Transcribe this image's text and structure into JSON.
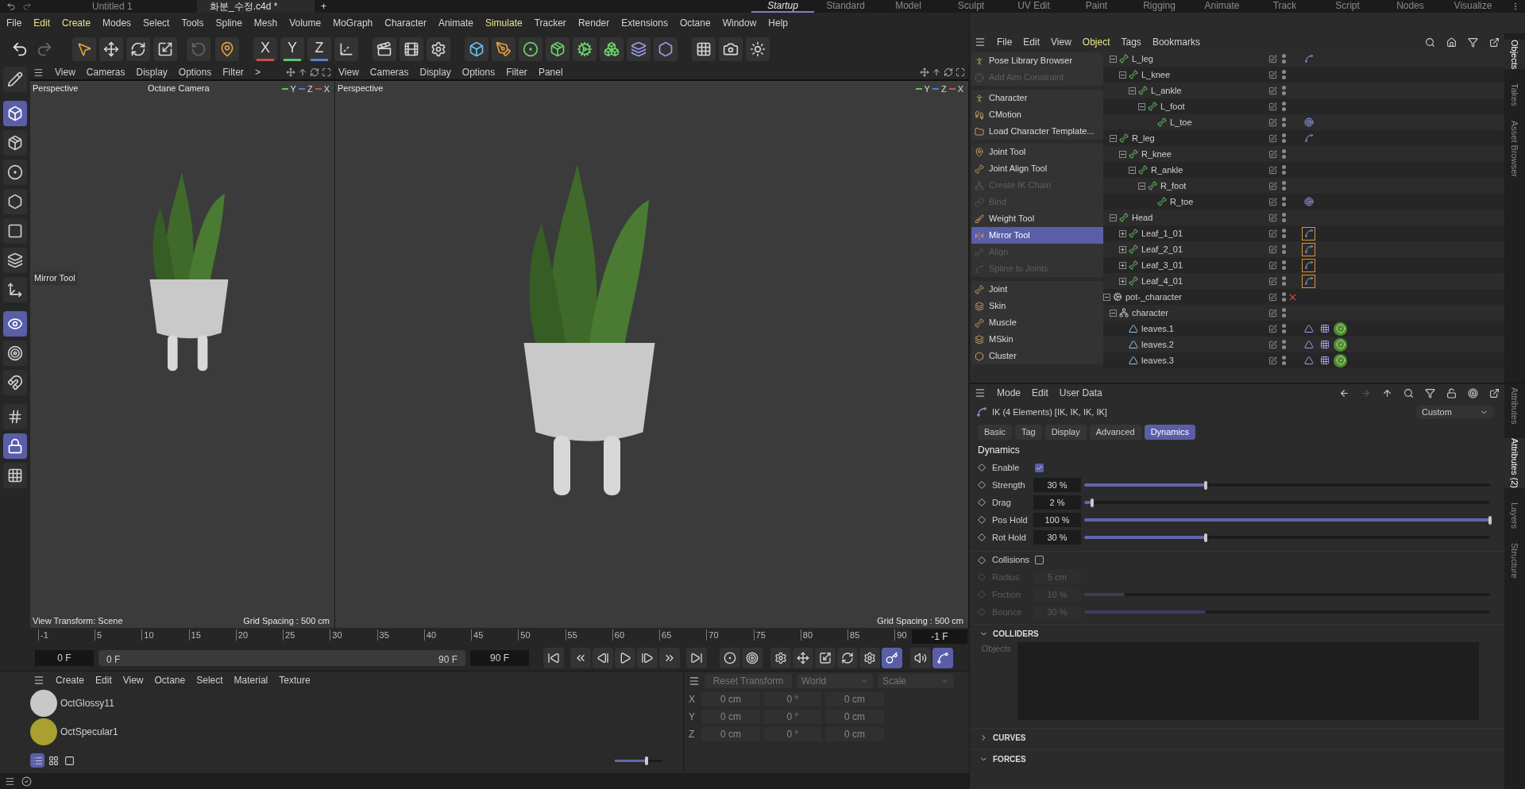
{
  "top_bar": {
    "tabs": [
      {
        "label": "Untitled 1",
        "selected": false
      },
      {
        "label": "화분_수정.c4d *",
        "selected": true
      }
    ],
    "new_tab": "+",
    "layouts": [
      {
        "label": "Startup",
        "selected": true
      },
      {
        "label": "Standard",
        "selected": false
      },
      {
        "label": "Model",
        "selected": false
      },
      {
        "label": "Sculpt",
        "selected": false
      },
      {
        "label": "UV Edit",
        "selected": false
      },
      {
        "label": "Paint",
        "selected": false
      },
      {
        "label": "Rigging",
        "selected": false
      },
      {
        "label": "Animate",
        "selected": false
      },
      {
        "label": "Track",
        "selected": false
      },
      {
        "label": "Script",
        "selected": false
      },
      {
        "label": "Nodes",
        "selected": false
      },
      {
        "label": "Visualize",
        "selected": false
      }
    ]
  },
  "menu": [
    {
      "label": "File",
      "highlighted": false
    },
    {
      "label": "Edit",
      "highlighted": true
    },
    {
      "label": "Create",
      "highlighted": true
    },
    {
      "label": "Modes",
      "highlighted": false
    },
    {
      "label": "Select",
      "highlighted": false
    },
    {
      "label": "Tools",
      "highlighted": false
    },
    {
      "label": "Spline",
      "highlighted": false
    },
    {
      "label": "Mesh",
      "highlighted": false
    },
    {
      "label": "Volume",
      "highlighted": false
    },
    {
      "label": "MoGraph",
      "highlighted": false
    },
    {
      "label": "Character",
      "highlighted": false
    },
    {
      "label": "Animate",
      "highlighted": false
    },
    {
      "label": "Simulate",
      "highlighted": true
    },
    {
      "label": "Tracker",
      "highlighted": false
    },
    {
      "label": "Render",
      "highlighted": false
    },
    {
      "label": "Extensions",
      "highlighted": false
    },
    {
      "label": "Octane",
      "highlighted": false
    },
    {
      "label": "Window",
      "highlighted": false
    },
    {
      "label": "Help",
      "highlighted": false
    }
  ],
  "axis_lock": [
    {
      "label": "X",
      "color": "#d24a4a"
    },
    {
      "label": "Y",
      "color": "#62c462"
    },
    {
      "label": "Z",
      "color": "#4f7fd8"
    }
  ],
  "left_tools": [
    {
      "kind": "edit",
      "selected": false
    },
    {
      "kind": "model",
      "selected": true
    },
    {
      "kind": "texture",
      "selected": false
    },
    {
      "kind": "point",
      "selected": false
    },
    {
      "kind": "edge",
      "selected": false
    },
    {
      "kind": "polygon",
      "selected": false
    },
    {
      "kind": "uv",
      "selected": false
    },
    {
      "kind": "axis",
      "selected": false
    },
    {
      "kind": "solo",
      "selected": true
    },
    {
      "kind": "auto",
      "selected": false
    },
    {
      "kind": "snap",
      "selected": false
    },
    {
      "kind": "grid",
      "selected": false
    },
    {
      "kind": "grid-lock",
      "selected": true
    },
    {
      "kind": "grid-auto",
      "selected": false
    }
  ],
  "viewports": [
    {
      "menu": [
        "View",
        "Cameras",
        "Display",
        "Options",
        "Filter",
        ">"
      ],
      "camera": "Perspective",
      "renderer": "Octane Camera",
      "tool": "Mirror Tool",
      "transform": "View Transform: Scene",
      "grid": "Grid Spacing : 500 cm",
      "gizmo": [
        {
          "label": "Y",
          "color": "#62c462"
        },
        {
          "label": "Z",
          "color": "#4f7fd8"
        },
        {
          "label": "X",
          "color": "#d24a4a"
        }
      ]
    },
    {
      "menu": [
        "View",
        "Cameras",
        "Display",
        "Options",
        "Filter",
        "Panel"
      ],
      "camera": "Perspective",
      "grid": "Grid Spacing : 500 cm",
      "gizmo": [
        {
          "label": "Y",
          "color": "#62c462"
        },
        {
          "label": "Z",
          "color": "#4f7fd8"
        },
        {
          "label": "X",
          "color": "#d24a4a"
        }
      ]
    }
  ],
  "timeline": {
    "ticks": [
      "-1",
      "5",
      "10",
      "15",
      "20",
      "25",
      "30",
      "35",
      "40",
      "45",
      "50",
      "55",
      "60",
      "65",
      "70",
      "75",
      "80",
      "85",
      "90"
    ],
    "current_frame": "-1 F",
    "start": "0 F",
    "range_start": "0 F",
    "range_end": "90 F",
    "range_bar": {
      "level": 1.0
    },
    "end": "90 F"
  },
  "key_tools": [
    {
      "kind": "record",
      "on": false
    },
    {
      "kind": "autokey",
      "on": false
    },
    {
      "kind": "keys",
      "on": false
    },
    {
      "kind": "position",
      "on": false
    },
    {
      "kind": "scale",
      "on": false
    },
    {
      "kind": "rotation",
      "on": false
    },
    {
      "kind": "parameter",
      "on": false
    },
    {
      "kind": "pla",
      "on": true
    },
    {
      "kind": "sound",
      "on": false
    },
    {
      "kind": "interpolation",
      "on": true
    }
  ],
  "materials": {
    "menu": [
      "Create",
      "Edit",
      "View",
      "Octane",
      "Select",
      "Material",
      "Texture"
    ],
    "items": [
      {
        "name": "OctGlossy11",
        "kind": "glossy"
      },
      {
        "name": "OctSpecular1",
        "kind": "specular"
      }
    ],
    "view_modes": [
      {
        "kind": "list",
        "selected": true
      },
      {
        "kind": "grid",
        "selected": false
      },
      {
        "kind": "large",
        "selected": false
      }
    ],
    "zoom": {
      "level": 0.66
    }
  },
  "coordinates": {
    "reset": "Reset Transform",
    "space": "World",
    "mode": "Scale",
    "rows": [
      {
        "axis": "X",
        "values": [
          "0 cm",
          "0 °",
          "0 cm"
        ]
      },
      {
        "axis": "Y",
        "values": [
          "0 cm",
          "0 °",
          "0 cm"
        ]
      },
      {
        "axis": "Z",
        "values": [
          "0 cm",
          "0 °",
          "0 cm"
        ]
      }
    ]
  },
  "object_manager": {
    "menu": [
      {
        "label": "File",
        "highlighted": false
      },
      {
        "label": "Edit",
        "highlighted": false
      },
      {
        "label": "View",
        "highlighted": false
      },
      {
        "label": "Object",
        "highlighted": true
      },
      {
        "label": "Tags",
        "highlighted": false
      },
      {
        "label": "Bookmarks",
        "highlighted": false
      }
    ],
    "character_menu": [
      [
        {
          "label": "Pose Library Browser",
          "kind": "pose",
          "disabled": false,
          "selected": false
        },
        {
          "label": "Add Aim Constraint",
          "kind": "aim",
          "disabled": true,
          "selected": false
        }
      ],
      [
        {
          "label": "Character",
          "kind": "character",
          "disabled": false,
          "selected": false
        },
        {
          "label": "CMotion",
          "kind": "cmotion",
          "disabled": false,
          "selected": false
        },
        {
          "label": "Load Character Template...",
          "kind": "folder",
          "disabled": false,
          "selected": false
        }
      ],
      [
        {
          "label": "Joint Tool",
          "kind": "joint-tool",
          "disabled": false,
          "selected": false
        },
        {
          "label": "Joint Align Tool",
          "kind": "align",
          "disabled": false,
          "selected": false
        },
        {
          "label": "Create IK Chain",
          "kind": "ik",
          "disabled": true,
          "selected": false
        },
        {
          "label": "Bind",
          "kind": "bind",
          "disabled": true,
          "selected": false
        },
        {
          "label": "Weight Tool",
          "kind": "weight",
          "disabled": false,
          "selected": false
        },
        {
          "label": "Mirror Tool",
          "kind": "mirror",
          "disabled": false,
          "selected": true
        },
        {
          "label": "Align",
          "kind": "align",
          "disabled": true,
          "selected": false
        },
        {
          "label": "Spline to Joints",
          "kind": "spline",
          "disabled": true,
          "selected": false
        }
      ],
      [
        {
          "label": "Joint",
          "kind": "joint",
          "disabled": false,
          "selected": false
        },
        {
          "label": "Skin",
          "kind": "skin",
          "disabled": false,
          "selected": false
        },
        {
          "label": "Muscle",
          "kind": "muscle",
          "disabled": false,
          "selected": false
        },
        {
          "label": "MSkin",
          "kind": "mskin",
          "disabled": false,
          "selected": false
        },
        {
          "label": "Cluster",
          "kind": "cluster",
          "disabled": false,
          "selected": false
        }
      ]
    ],
    "tree": [
      {
        "children": [
          {
            "name": "L_leg",
            "kind": "joint",
            "expanded": true,
            "tags": [
              {
                "kind": "ik",
                "selected": false
              }
            ],
            "children": [
              {
                "name": "L_knee",
                "kind": "joint",
                "expanded": true,
                "children": [
                  {
                    "name": "L_ankle",
                    "kind": "joint",
                    "expanded": true,
                    "children": [
                      {
                        "name": "L_foot",
                        "kind": "joint",
                        "expanded": true,
                        "children": [
                          {
                            "name": "L_toe",
                            "kind": "joint",
                            "tags": [
                              {
                                "kind": "goal",
                                "selected": false
                              }
                            ]
                          }
                        ]
                      }
                    ]
                  }
                ]
              }
            ]
          },
          {
            "name": "R_leg",
            "kind": "joint",
            "expanded": true,
            "tags": [
              {
                "kind": "ik",
                "selected": false
              }
            ],
            "children": [
              {
                "name": "R_knee",
                "kind": "joint",
                "expanded": true,
                "children": [
                  {
                    "name": "R_ankle",
                    "kind": "joint",
                    "expanded": true,
                    "children": [
                      {
                        "name": "R_foot",
                        "kind": "joint",
                        "expanded": true,
                        "children": [
                          {
                            "name": "R_toe",
                            "kind": "joint",
                            "tags": [
                              {
                                "kind": "goal",
                                "selected": false
                              }
                            ]
                          }
                        ]
                      }
                    ]
                  }
                ]
              }
            ]
          },
          {
            "name": "Head",
            "kind": "joint",
            "expanded": true,
            "children": [
              {
                "name": "Leaf_1_01",
                "kind": "joint",
                "expanded": false,
                "tags": [
                  {
                    "kind": "ik",
                    "selected": true
                  }
                ]
              },
              {
                "name": "Leaf_2_01",
                "kind": "joint",
                "expanded": false,
                "tags": [
                  {
                    "kind": "ik",
                    "selected": true
                  }
                ]
              },
              {
                "name": "Leaf_3_01",
                "kind": "joint",
                "expanded": false,
                "tags": [
                  {
                    "kind": "ik",
                    "selected": true
                  }
                ]
              },
              {
                "name": "Leaf_4_01",
                "kind": "joint",
                "expanded": false,
                "tags": [
                  {
                    "kind": "ik",
                    "selected": true
                  }
                ]
              }
            ]
          }
        ]
      },
      {
        "name": "pot-_character",
        "kind": "character",
        "expanded": true,
        "disabled": true,
        "children": [
          {
            "name": "character",
            "kind": "skeleton",
            "expanded": true,
            "children": [
              {
                "name": "leaves.1",
                "kind": "mesh",
                "tags": [
                  {
                    "kind": "phong",
                    "selected": false
                  },
                  {
                    "kind": "checker",
                    "selected": false
                  },
                  {
                    "kind": "material",
                    "selected": false
                  }
                ]
              },
              {
                "name": "leaves.2",
                "kind": "mesh",
                "tags": [
                  {
                    "kind": "phong",
                    "selected": false
                  },
                  {
                    "kind": "checker",
                    "selected": false
                  },
                  {
                    "kind": "material",
                    "selected": false
                  }
                ]
              },
              {
                "name": "leaves.3",
                "kind": "mesh",
                "tags": [
                  {
                    "kind": "phong",
                    "selected": false
                  },
                  {
                    "kind": "checker",
                    "selected": false
                  },
                  {
                    "kind": "material",
                    "selected": false
                  }
                ]
              }
            ]
          }
        ]
      }
    ]
  },
  "attributes": {
    "menu": [
      "Mode",
      "Edit",
      "User Data"
    ],
    "title": "IK (4 Elements) [IK, IK, IK, IK]",
    "preset": "Custom",
    "tabs": [
      {
        "label": "Basic",
        "selected": false
      },
      {
        "label": "Tag",
        "selected": false
      },
      {
        "label": "Display",
        "selected": false
      },
      {
        "label": "Advanced",
        "selected": false
      },
      {
        "label": "Dynamics",
        "selected": true
      }
    ],
    "section": "Dynamics",
    "params": [
      {
        "label": "Enable",
        "kind": "checkbox",
        "checked": true,
        "disabled": false
      },
      {
        "label": "Strength",
        "kind": "slider",
        "value": "30 %",
        "level": 0.3,
        "disabled": false
      },
      {
        "label": "Drag",
        "kind": "slider",
        "value": "2 %",
        "level": 0.02,
        "disabled": false
      },
      {
        "label": "Pos Hold",
        "kind": "slider",
        "value": "100 %",
        "level": 1.0,
        "disabled": false
      },
      {
        "label": "Rot Hold",
        "kind": "slider",
        "value": "30 %",
        "level": 0.3,
        "disabled": false
      },
      {
        "label": "Collisions",
        "kind": "checkbox",
        "checked": false,
        "disabled": false
      },
      {
        "label": "Radius",
        "kind": "field",
        "value": "5 cm",
        "disabled": true
      },
      {
        "label": "Friction",
        "kind": "slider",
        "value": "10 %",
        "level": 0.1,
        "disabled": true
      },
      {
        "label": "Bounce",
        "kind": "slider",
        "value": "30 %",
        "level": 0.3,
        "disabled": true
      }
    ],
    "groups": [
      {
        "label": "COLLIDERS",
        "expanded": true,
        "list_label": "Objects"
      },
      {
        "label": "CURVES",
        "expanded": false
      },
      {
        "label": "FORCES",
        "expanded": true
      }
    ]
  },
  "side_tabs_top": [
    {
      "label": "Objects",
      "selected": true
    },
    {
      "label": "Takes",
      "selected": false
    },
    {
      "label": "Asset Browser",
      "selected": false
    }
  ],
  "side_tabs_bottom": [
    {
      "label": "Attributes",
      "selected": false
    },
    {
      "label": "Attributes (2)",
      "selected": true
    },
    {
      "label": "Layers",
      "selected": false
    },
    {
      "label": "Structure",
      "selected": false
    }
  ]
}
